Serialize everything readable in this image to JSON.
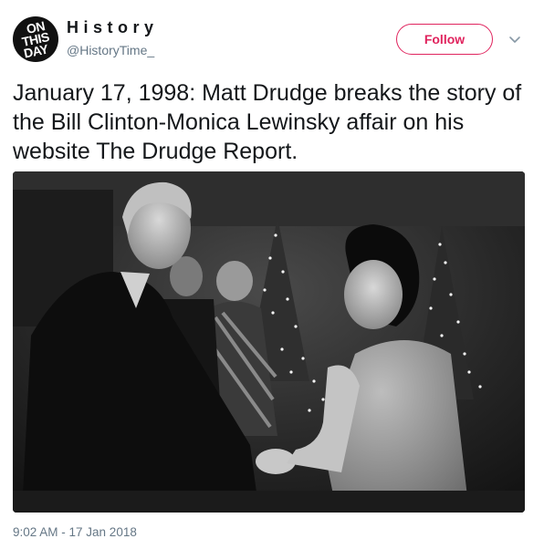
{
  "account": {
    "avatar_lines": [
      "ON",
      "THIS",
      "DAY"
    ],
    "display_name": "History",
    "handle": "@HistoryTime_"
  },
  "actions": {
    "follow_label": "Follow",
    "more_icon": "chevron-down-icon"
  },
  "tweet": {
    "text": "January 17, 1998: Matt Drudge breaks the story of the Bill Clinton-Monica Lewinsky affair on his website The Drudge Report.",
    "timestamp": "9:02 AM - 17 Jan 2018"
  },
  "colors": {
    "accent": "#e0245e",
    "secondary_text": "#657786",
    "primary_text": "#14171a"
  }
}
